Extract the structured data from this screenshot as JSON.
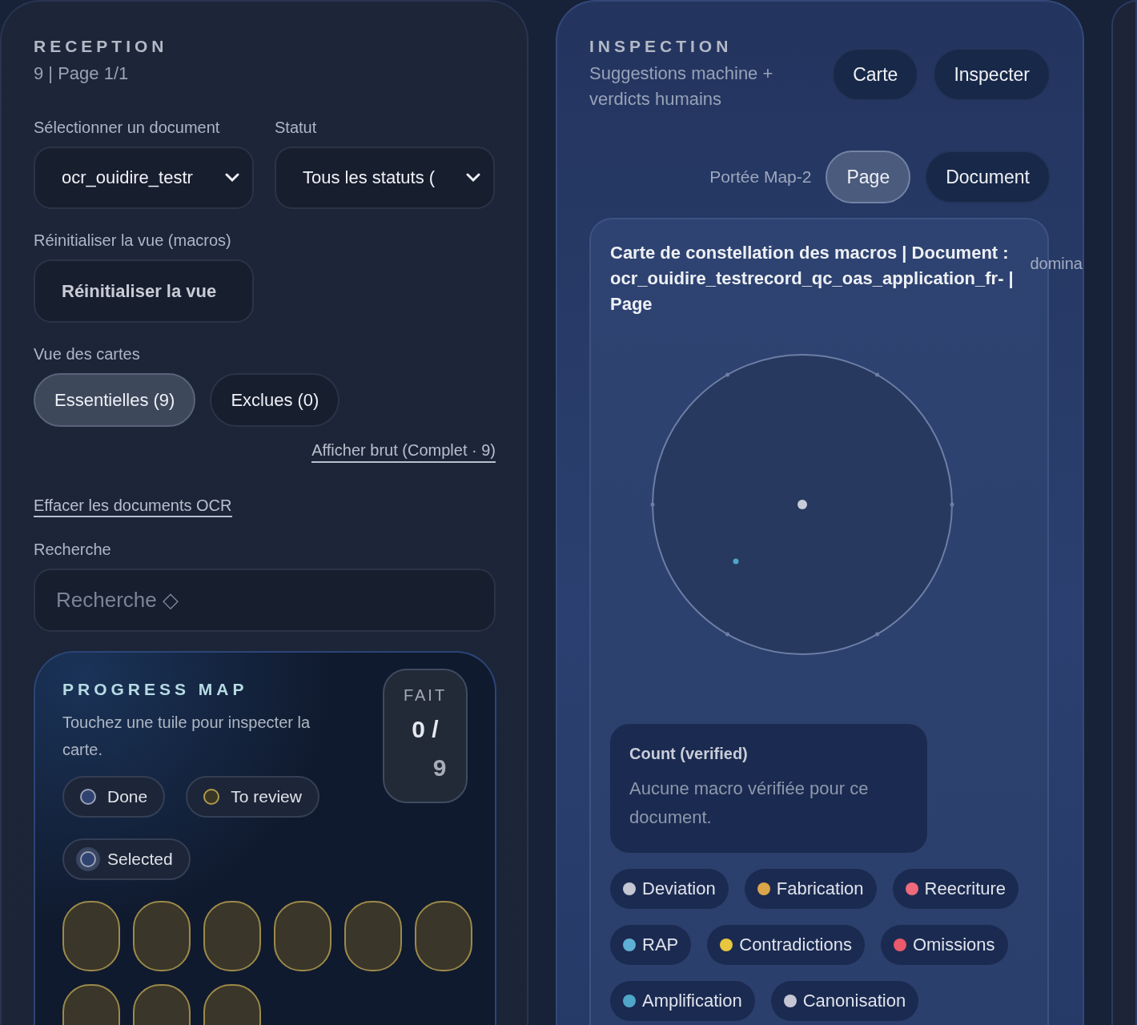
{
  "reception": {
    "title": "RECEPTION",
    "subtitle": "9 | Page 1/1",
    "filters": [
      {
        "label": "Sélectionner un document",
        "value": "ocr_ouidire_testr"
      },
      {
        "label": "Statut",
        "value": "Tous les statuts ("
      }
    ],
    "reset": {
      "label": "Réinitialiser la vue (macros)",
      "button": "Réinitialiser la vue"
    },
    "view": {
      "label": "Vue des cartes",
      "options": [
        {
          "label": "Essentielles (9)",
          "selected": true
        },
        {
          "label": "Exclues (0)",
          "selected": false
        }
      ]
    },
    "raw_link": "Afficher brut (Complet · 9)",
    "clear_link": "Effacer les documents OCR",
    "search": {
      "label": "Recherche",
      "placeholder": "Recherche ◇"
    },
    "progress": {
      "title": "PROGRESS MAP",
      "hint": "Touchez une tuile pour inspecter la carte.",
      "done_label": "FAIT",
      "done_count": "0 /",
      "total": "9",
      "legend": [
        {
          "label": "Done",
          "kind": "done"
        },
        {
          "label": "To review",
          "kind": "review"
        },
        {
          "label": "Selected",
          "kind": "selected"
        }
      ],
      "tiles": [
        {
          "kind": "review"
        },
        {
          "kind": "review"
        },
        {
          "kind": "review"
        },
        {
          "kind": "review"
        },
        {
          "kind": "review"
        },
        {
          "kind": "review"
        },
        {
          "kind": "review"
        },
        {
          "kind": "review"
        },
        {
          "kind": "review"
        }
      ]
    }
  },
  "inspection": {
    "title": "INSPECTION",
    "subtitle": "Suggestions machine + verdicts humains",
    "actions": [
      "Carte",
      "Inspecter"
    ],
    "scope": {
      "label": "Portée Map-2",
      "options": [
        {
          "label": "Page",
          "selected": true
        },
        {
          "label": "Document",
          "selected": false
        }
      ]
    },
    "map": {
      "title": "Carte de constellation des macros | Document : ocr_ouidire_testrecord_qc_oas_application_fr- | Page",
      "side_label": "domina",
      "count": {
        "title": "Count (verified)",
        "text": "Aucune macro vérifiée pour ce document."
      },
      "categories": [
        {
          "label": "Deviation",
          "color": "#c4c6d4"
        },
        {
          "label": "Fabrication",
          "color": "#dba54a"
        },
        {
          "label": "Reecriture",
          "color": "#ee6a7c"
        },
        {
          "label": "RAP",
          "color": "#5fb0d6"
        },
        {
          "label": "Contradictions",
          "color": "#e8c73e"
        },
        {
          "label": "Omissions",
          "color": "#ea5a6a"
        },
        {
          "label": "Amplification",
          "color": "#4fa6c8"
        },
        {
          "label": "Canonisation",
          "color": "#c4c6d4"
        }
      ]
    }
  }
}
